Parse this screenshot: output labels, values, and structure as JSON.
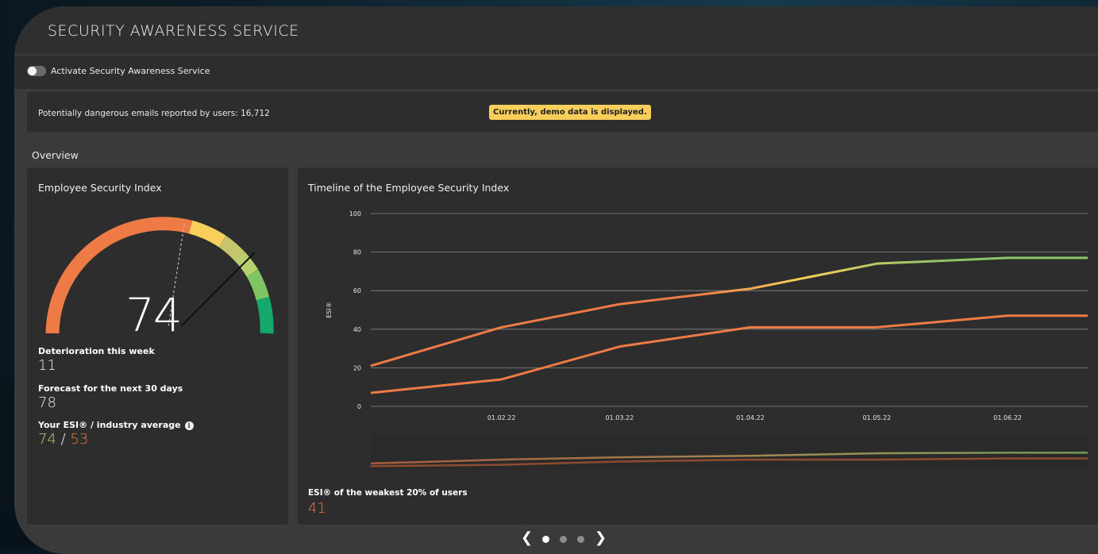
{
  "header": {
    "title": "SECURITY AWARENESS SERVICE"
  },
  "toggle": {
    "label": "Activate Security Awareness Service",
    "state": "off"
  },
  "info_bar": {
    "reported_text": "Potentially dangerous emails reported by users: 16,712",
    "demo_badge": "Currently, demo data is displayed."
  },
  "overview": {
    "title": "Overview"
  },
  "esi_card": {
    "title": "Employee Security Index",
    "gauge_value": "74",
    "deterioration_label": "Deterioration this week",
    "deterioration_value": "11",
    "forecast_label": "Forecast for the next 30 days",
    "forecast_value": "78",
    "compare_label": "Your ESI® / industry average",
    "your_esi": "74",
    "slash": " / ",
    "industry_avg": "53",
    "info_icon": "info-icon"
  },
  "timeline_card": {
    "title": "Timeline of the Employee Security Index",
    "weakest_label": "ESI® of the weakest 20% of users",
    "weakest_value": "41"
  },
  "colors": {
    "orange": "#ee7b45",
    "yellow": "#f7cf5a",
    "green": "#8cc46a",
    "dark_green": "#17a86b",
    "olive": "#c5cf6c"
  },
  "chart_data": {
    "type": "line",
    "title": "Timeline of the Employee Security Index",
    "xlabel": "",
    "ylabel": "ESI®",
    "ylim": [
      0,
      100
    ],
    "yticks": [
      "100",
      "80",
      "60",
      "40",
      "20",
      "0"
    ],
    "xticks": [
      "01.02.22",
      "01.03.22",
      "01.04.22",
      "01.05.22",
      "01.06.22"
    ],
    "x": [
      "2022-01-01",
      "2022-02-01",
      "2022-03-01",
      "2022-04-01",
      "2022-05-01",
      "2022-06-01",
      "2022-06-20"
    ],
    "series": [
      {
        "values": [
          21,
          41,
          53,
          61,
          74,
          77,
          77
        ]
      },
      {
        "values": [
          7,
          14,
          31,
          41,
          41,
          47,
          47
        ]
      }
    ],
    "grid": true
  },
  "carousel": {
    "prev": "‹",
    "next": "›",
    "pages": 3,
    "active": 0
  }
}
